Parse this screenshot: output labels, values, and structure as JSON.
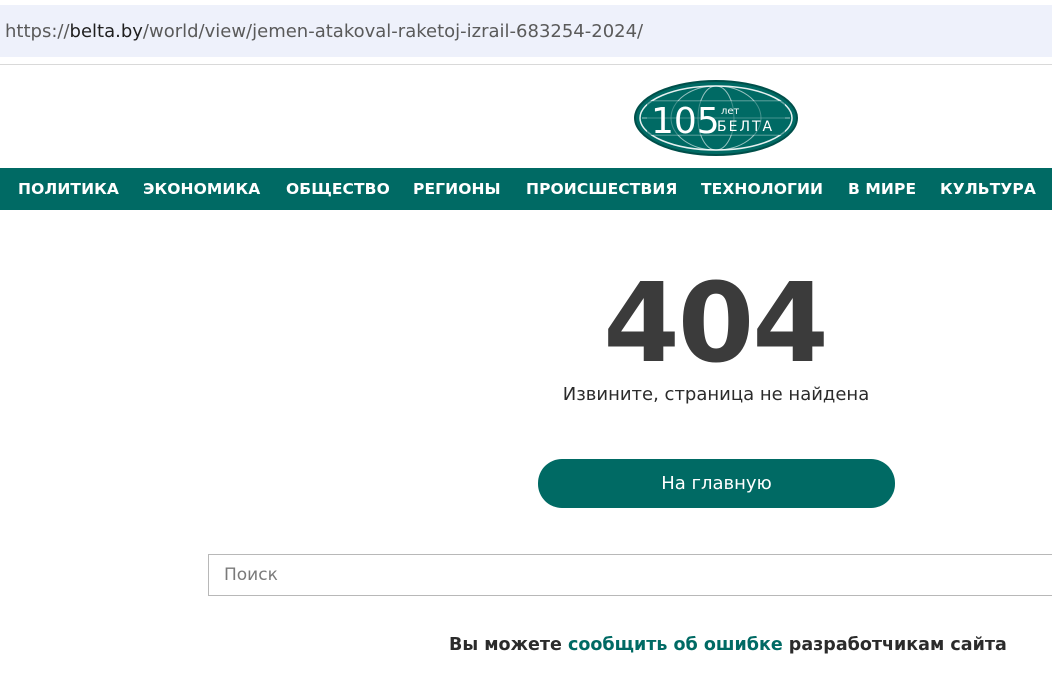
{
  "browser": {
    "url_scheme": "https://",
    "url_host": "belta.by",
    "url_path": "/world/view/jemen-atakoval-raketoj-izrail-683254-2024/"
  },
  "logo": {
    "number": "105",
    "small_text": "лет",
    "brand": "БЕЛТА"
  },
  "nav": {
    "items": [
      {
        "label": "ПОЛИТИКА"
      },
      {
        "label": "ЭКОНОМИКА"
      },
      {
        "label": "ОБЩЕСТВО"
      },
      {
        "label": "РЕГИОНЫ"
      },
      {
        "label": "ПРОИСШЕСТВИЯ"
      },
      {
        "label": "ТЕХНОЛОГИИ"
      },
      {
        "label": "В МИРЕ"
      },
      {
        "label": "КУЛЬТУРА"
      }
    ]
  },
  "error": {
    "code": "404",
    "message": "Извините, страница не найдена",
    "home_label": "На главную"
  },
  "search": {
    "placeholder": "Поиск"
  },
  "report": {
    "prefix": "Вы можете ",
    "link": "сообщить об ошибке",
    "suffix": " разработчикам сайта"
  },
  "colors": {
    "brand": "#006a64",
    "text": "#3b3b3b"
  }
}
